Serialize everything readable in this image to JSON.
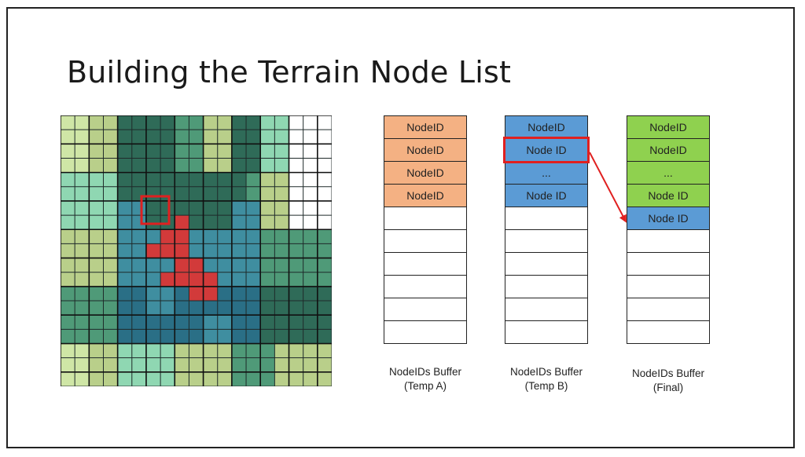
{
  "title": "Building the Terrain Node List",
  "colors": {
    "orange": "#f4b183",
    "blue": "#5b9bd5",
    "green": "#8fd14f",
    "highlight": "#e02020",
    "grid_line": "#1f2a2a"
  },
  "buffers": [
    {
      "caption_line1": "NodeIDs Buffer",
      "caption_line2": "(Temp A)",
      "cells": [
        "NodeID",
        "NodeID",
        "NodeID",
        "NodeID",
        "",
        "",
        "",
        "",
        "",
        ""
      ]
    },
    {
      "caption_line1": "NodeIDs Buffer",
      "caption_line2": "(Temp B)",
      "cells": [
        "NodeID",
        "Node ID",
        "...",
        "Node ID",
        "",
        "",
        "",
        "",
        "",
        ""
      ]
    },
    {
      "caption_line1": "NodeIDs Buffer",
      "caption_line2": "(Final)",
      "cells": [
        "NodeID",
        "NodeID",
        "...",
        "Node ID",
        "Node ID",
        "",
        "",
        "",
        "",
        ""
      ]
    }
  ]
}
